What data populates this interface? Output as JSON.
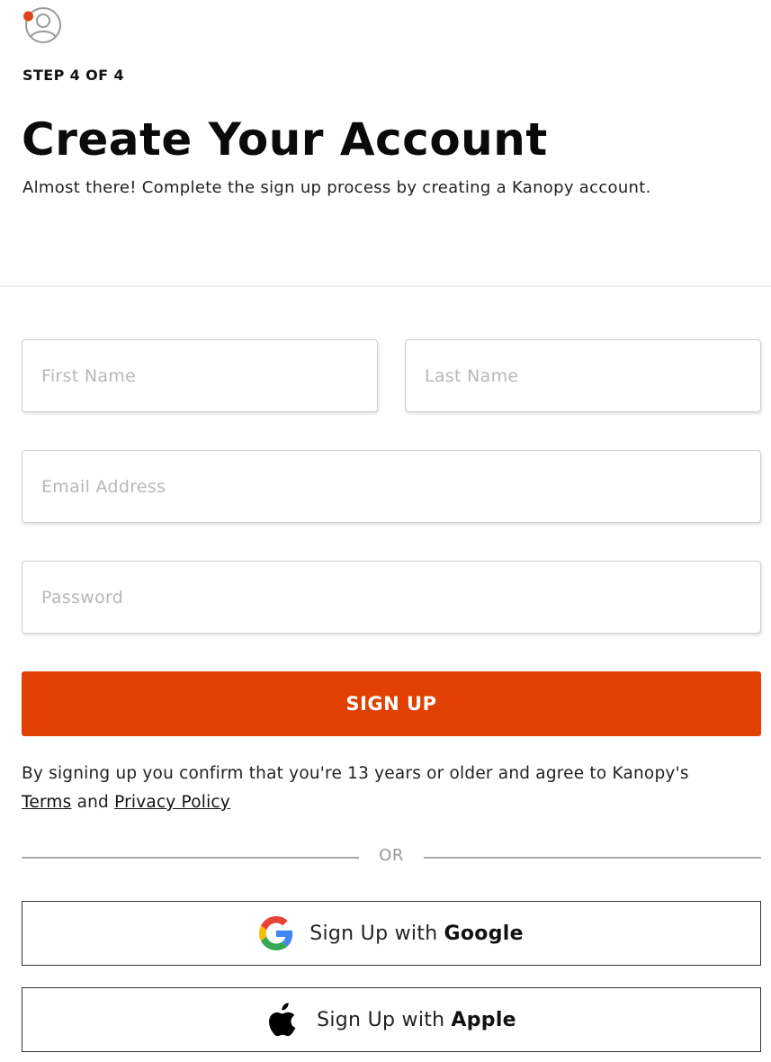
{
  "header": {
    "step": "STEP 4 OF 4",
    "title": "Create Your Account",
    "subtitle": "Almost there! Complete the sign up process by creating a Kanopy account."
  },
  "form": {
    "first_name": {
      "placeholder": "First Name",
      "value": ""
    },
    "last_name": {
      "placeholder": "Last Name",
      "value": ""
    },
    "email": {
      "placeholder": "Email Address",
      "value": ""
    },
    "password": {
      "placeholder": "Password",
      "value": ""
    },
    "submit_label": "SIGN UP"
  },
  "legal": {
    "prefix": "By signing up you confirm that you're 13 years or older and agree to Kanopy's",
    "terms_label": "Terms",
    "and": "and",
    "privacy_label": "Privacy Policy"
  },
  "separator": "OR",
  "social": {
    "google": {
      "prefix": "Sign Up with",
      "brand": "Google",
      "icon": "google-icon"
    },
    "apple": {
      "prefix": "Sign Up with",
      "brand": "Apple",
      "icon": "apple-icon"
    }
  },
  "colors": {
    "accent": "#e04000",
    "avatar_badge": "#e0441b"
  }
}
